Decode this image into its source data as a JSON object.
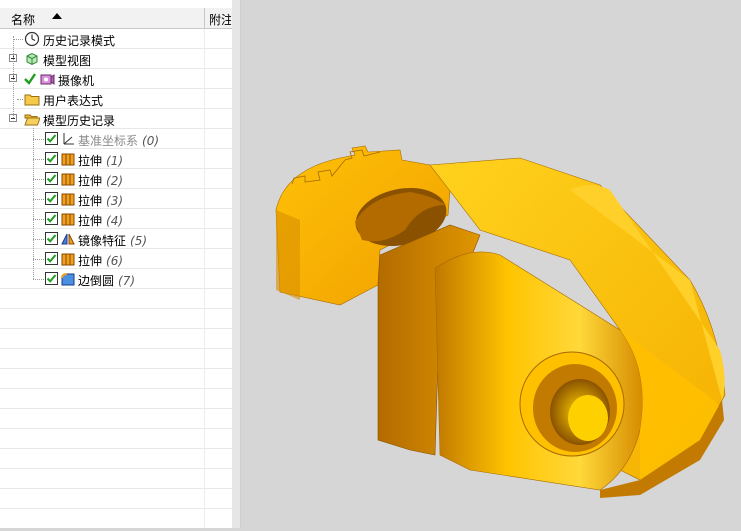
{
  "tree": {
    "columns": {
      "name": "名称",
      "attach": "附注"
    },
    "nodes": [
      {
        "label": "历史记录模式",
        "num": "",
        "icon": "clock-icon",
        "expander": "",
        "checkbox": false,
        "level": 0
      },
      {
        "label": "模型视图",
        "num": "",
        "icon": "model-views-icon",
        "expander": "plus",
        "checkbox": false,
        "level": 0
      },
      {
        "label": "摄像机",
        "num": "",
        "icon": "camera-icon",
        "expander": "plus",
        "checkbox": false,
        "level": 0,
        "check_mark": true
      },
      {
        "label": "用户表达式",
        "num": "",
        "icon": "folder-icon",
        "expander": "",
        "checkbox": false,
        "level": 0
      },
      {
        "label": "模型历史记录",
        "num": "",
        "icon": "open-folder-icon",
        "expander": "minus",
        "checkbox": false,
        "level": 0
      },
      {
        "label": "基准坐标系",
        "num": "(0)",
        "icon": "datum-csys-icon",
        "checkbox": true,
        "level": 1,
        "dim": true
      },
      {
        "label": "拉伸",
        "num": "(1)",
        "icon": "extrude-icon",
        "checkbox": true,
        "level": 1
      },
      {
        "label": "拉伸",
        "num": "(2)",
        "icon": "extrude-icon",
        "checkbox": true,
        "level": 1
      },
      {
        "label": "拉伸",
        "num": "(3)",
        "icon": "extrude-icon",
        "checkbox": true,
        "level": 1
      },
      {
        "label": "拉伸",
        "num": "(4)",
        "icon": "extrude-icon",
        "checkbox": true,
        "level": 1
      },
      {
        "label": "镜像特征",
        "num": "(5)",
        "icon": "mirror-feature-icon",
        "checkbox": true,
        "level": 1
      },
      {
        "label": "拉伸",
        "num": "(6)",
        "icon": "extrude-icon",
        "checkbox": true,
        "level": 1
      },
      {
        "label": "边倒圆",
        "num": "(7)",
        "icon": "edge-blend-icon",
        "checkbox": true,
        "level": 1
      }
    ],
    "empty_rows": 12
  },
  "viewport": {
    "background": "#d6d6d6",
    "model_color": "#f0a800",
    "model_name": "3d-part-model"
  }
}
